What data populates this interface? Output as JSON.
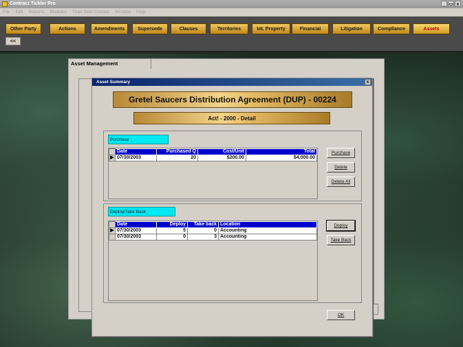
{
  "window": {
    "title": "Contract Tickler Pro"
  },
  "menu": [
    "File",
    "Edit",
    "Reports",
    "Modules",
    "Their Side Contact",
    "Window",
    "Help"
  ],
  "toolbar": {
    "buttons": [
      "Other Party",
      "Actions",
      "Amendments",
      "Supersede",
      "Clauses",
      "Territories",
      "Int. Property",
      "Financial",
      "Litigation",
      "Compliance",
      "Assets"
    ],
    "back": "<<"
  },
  "asset_mgmt": {
    "tab": "Asset Management"
  },
  "dialog": {
    "title": "Asset Summary",
    "close": "x",
    "agreement": "Gretel Saucers Distribution Agreement (DUP) - 00224",
    "detail": "Act! - 2000 - Detail",
    "purchase": {
      "label": "Purchase",
      "columns": [
        "Date",
        "Purchased Q",
        "Cost/Unit",
        "Total"
      ],
      "rows": [
        [
          "07/30/2003",
          "20",
          "$200.00",
          "$4,000.00"
        ]
      ],
      "buttons": [
        "Purchase",
        "Delete",
        "Delete All"
      ]
    },
    "deploy": {
      "label": "Deploy/Take Back",
      "columns": [
        "Date",
        "Deploy",
        "Take back",
        "Location"
      ],
      "rows": [
        [
          "07/30/2003",
          "5",
          "0",
          "Accounting"
        ],
        [
          "07/30/2003",
          "0",
          "3",
          "Accounting"
        ]
      ],
      "buttons": [
        "Deploy",
        "Take Back"
      ]
    },
    "ok": "OK"
  }
}
